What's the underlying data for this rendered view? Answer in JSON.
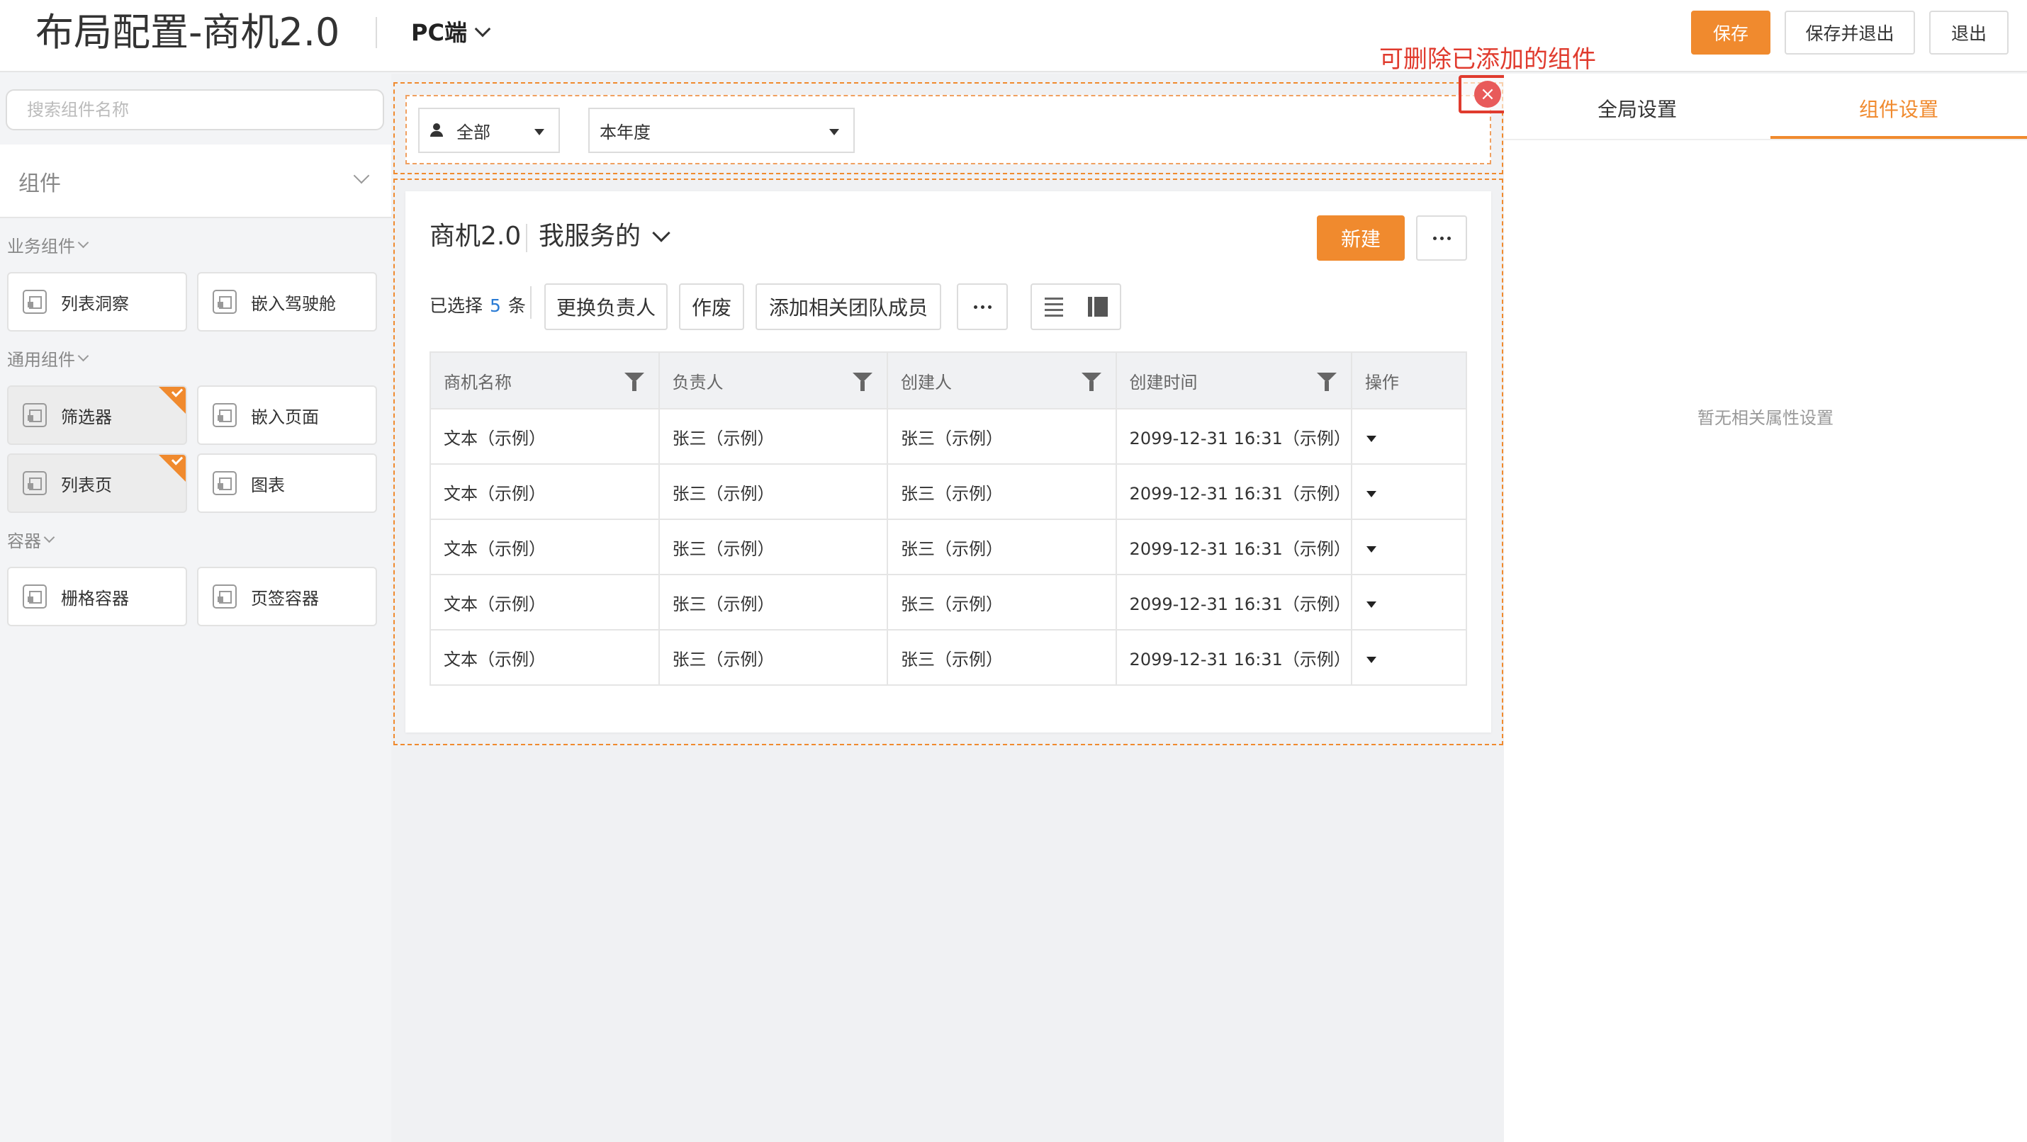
{
  "header": {
    "title": "布局配置-商机2.0",
    "platform": "PC端",
    "save_label": "保存",
    "save_exit_label": "保存并退出",
    "exit_label": "退出"
  },
  "left_panel": {
    "search_placeholder": "搜索组件名称",
    "components_title": "组件",
    "categories": [
      {
        "name": "业务组件",
        "items": [
          {
            "label": "列表洞察",
            "added": false
          },
          {
            "label": "嵌入驾驶舱",
            "added": false
          }
        ]
      },
      {
        "name": "通用组件",
        "items": [
          {
            "label": "筛选器",
            "added": true
          },
          {
            "label": "嵌入页面",
            "added": false
          },
          {
            "label": "列表页",
            "added": true
          },
          {
            "label": "图表",
            "added": false
          }
        ]
      },
      {
        "name": "容器",
        "items": [
          {
            "label": "栅格容器",
            "added": false
          },
          {
            "label": "页签容器",
            "added": false
          }
        ]
      }
    ]
  },
  "canvas": {
    "annotation": "可删除已添加的组件",
    "filter": {
      "owner_select": "全部",
      "period_select": "本年度"
    },
    "list": {
      "title": "商机2.0",
      "view_name": "我服务的",
      "new_label": "新建",
      "selected_prefix": "已选择",
      "selected_count": "5",
      "selected_suffix": "条",
      "actions": [
        "更换负责人",
        "作废",
        "添加相关团队成员"
      ],
      "columns": [
        "商机名称",
        "负责人",
        "创建人",
        "创建时间",
        "操作"
      ],
      "rows": [
        [
          "文本（示例）",
          "张三（示例）",
          "张三（示例）",
          "2099-12-31 16:31（示例）"
        ],
        [
          "文本（示例）",
          "张三（示例）",
          "张三（示例）",
          "2099-12-31 16:31（示例）"
        ],
        [
          "文本（示例）",
          "张三（示例）",
          "张三（示例）",
          "2099-12-31 16:31（示例）"
        ],
        [
          "文本（示例）",
          "张三（示例）",
          "张三（示例）",
          "2099-12-31 16:31（示例）"
        ],
        [
          "文本（示例）",
          "张三（示例）",
          "张三（示例）",
          "2099-12-31 16:31（示例）"
        ]
      ]
    }
  },
  "right_panel": {
    "tabs": [
      "全局设置",
      "组件设置"
    ],
    "active_tab": "组件设置",
    "empty_hint": "暂无相关属性设置"
  },
  "colors": {
    "accent": "#f08a2e",
    "annotation": "#e03b2e",
    "count": "#2a7bd4"
  }
}
